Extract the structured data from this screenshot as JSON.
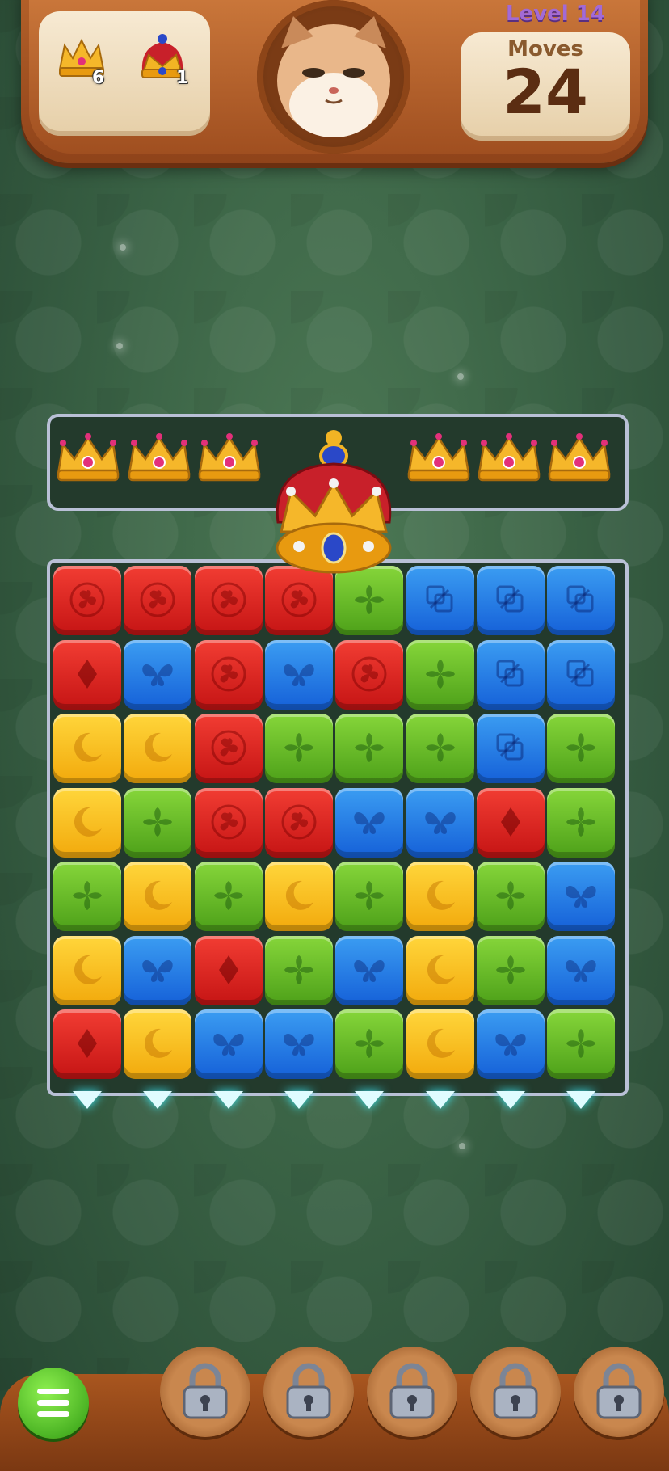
{
  "header": {
    "level_label": "Level 14",
    "moves_label": "Moves",
    "moves_value": "24",
    "goals": [
      {
        "icon": "small-crown-icon",
        "count": "6"
      },
      {
        "icon": "royal-crown-icon",
        "count": "1"
      }
    ],
    "portrait": "cat-portrait"
  },
  "board": {
    "crown_row": [
      "crown",
      "crown",
      "crown",
      "empty",
      "empty",
      "crown",
      "crown",
      "crown"
    ],
    "grid": [
      [
        "red",
        "red",
        "red",
        "red",
        "green",
        "blue",
        "blue",
        "blue"
      ],
      [
        "red",
        "blue",
        "red",
        "blue",
        "red",
        "green",
        "blue",
        "blue"
      ],
      [
        "yellow",
        "yellow",
        "red",
        "green",
        "green",
        "green",
        "blue",
        "green"
      ],
      [
        "yellow",
        "green",
        "red",
        "red",
        "blue",
        "blue",
        "red",
        "green"
      ],
      [
        "green",
        "yellow",
        "green",
        "yellow",
        "green",
        "yellow",
        "green",
        "blue"
      ],
      [
        "yellow",
        "blue",
        "red",
        "green",
        "blue",
        "yellow",
        "green",
        "blue"
      ],
      [
        "red",
        "yellow",
        "blue",
        "blue",
        "green",
        "yellow",
        "blue",
        "green"
      ]
    ],
    "special_pieces": {
      "red": [
        "flower",
        "flower",
        "flower",
        "flower",
        "diamond",
        "flower",
        "flower",
        "flower",
        "flower",
        "flower",
        "diamond",
        "diamond",
        "diamond"
      ]
    }
  },
  "bottom": {
    "menu_icon": "menu-list-icon",
    "locked_boosters": 5
  },
  "colors": {
    "red": "#e52a22",
    "blue": "#2a7ee6",
    "green": "#6cbf2a",
    "yellow": "#f7c020",
    "frame": "#b9c0d6"
  }
}
